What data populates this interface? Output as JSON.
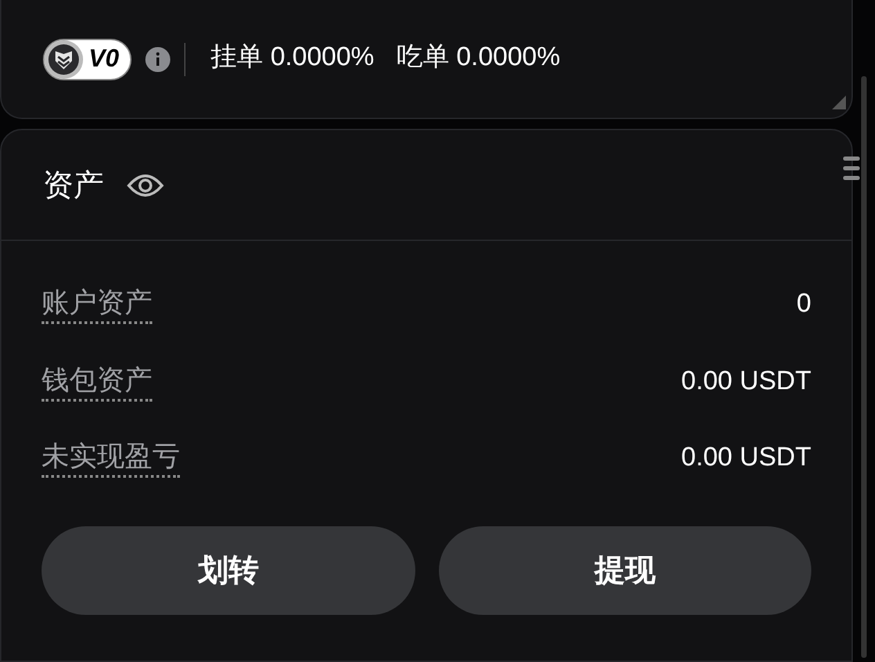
{
  "fee_bar": {
    "vip_badge": "V0",
    "maker_label": "挂单",
    "maker_fee": "0.0000%",
    "taker_label": "吃单",
    "taker_fee": "0.0000%"
  },
  "assets": {
    "title": "资产",
    "rows": [
      {
        "label": "账户资产",
        "value": "0"
      },
      {
        "label": "钱包资产",
        "value": "0.00 USDT"
      },
      {
        "label": "未实现盈亏",
        "value": "0.00 USDT"
      }
    ],
    "buttons": [
      "划转",
      "提现"
    ]
  }
}
